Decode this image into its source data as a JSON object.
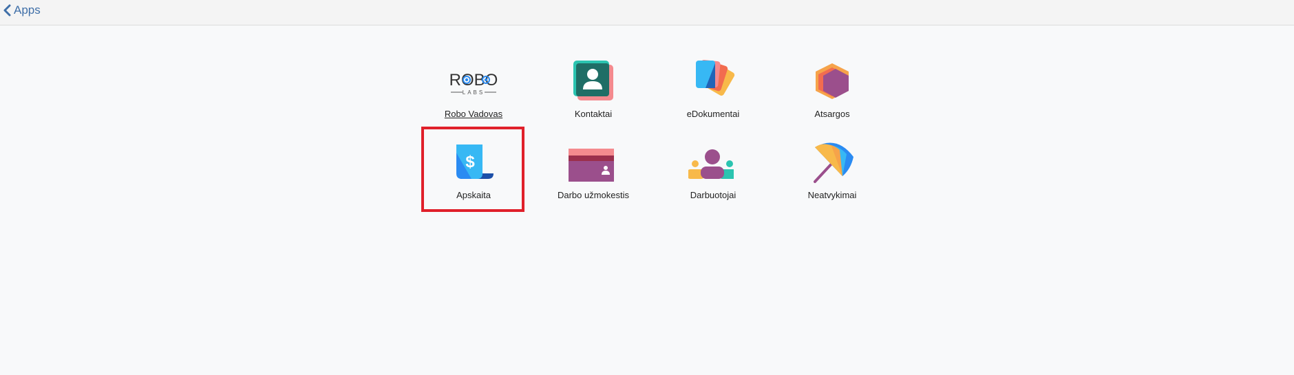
{
  "header": {
    "back_label": "Apps"
  },
  "apps": [
    {
      "label": "Robo Vadovas",
      "icon": "robo-labs-logo",
      "logo_top": "ROBO",
      "logo_bottom": "LABS"
    },
    {
      "label": "Kontaktai",
      "icon": "contact-card-icon"
    },
    {
      "label": "eDokumentai",
      "icon": "documents-icon"
    },
    {
      "label": "Atsargos",
      "icon": "inventory-cube-icon"
    },
    {
      "label": "Apskaita",
      "icon": "accounting-scroll-icon"
    },
    {
      "label": "Darbo užmokestis",
      "icon": "payroll-card-icon"
    },
    {
      "label": "Darbuotojai",
      "icon": "employees-icon"
    },
    {
      "label": "Neatvykimai",
      "icon": "umbrella-icon"
    }
  ],
  "colors": {
    "accent_link": "#3f6fa8",
    "highlight": "#e0202a",
    "teal": "#2bc4b0",
    "dark_green": "#1f6e66",
    "pink": "#f48a8e",
    "purple": "#9b4f8c",
    "orange": "#f6a34a",
    "blue": "#2a8bf2",
    "light_blue": "#37b8f4",
    "navy": "#1c4fa8",
    "yellow": "#f8b94a"
  }
}
